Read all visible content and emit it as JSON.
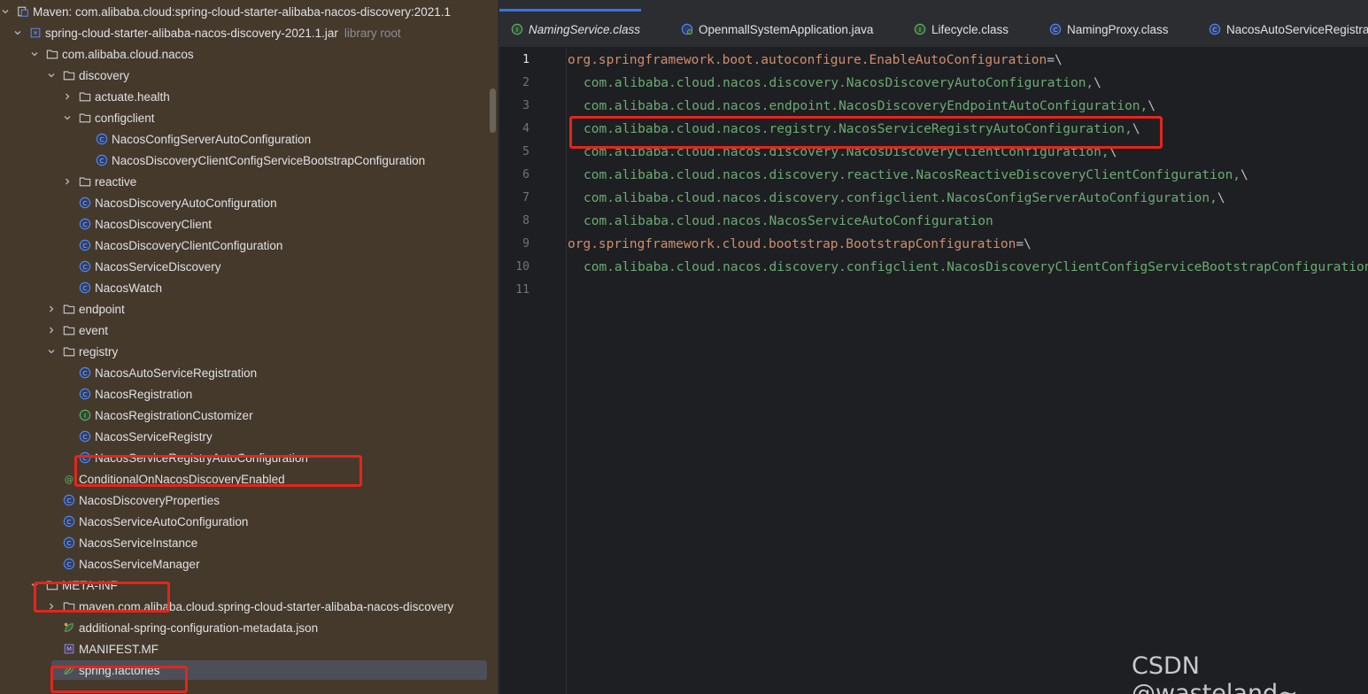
{
  "tree": {
    "rows": [
      {
        "label": "Maven: com.alibaba.cloud:spring-cloud-starter-alibaba-nacos-discovery:2021.1",
        "icon": "library-icon",
        "chev": "down"
      },
      {
        "label": "spring-cloud-starter-alibaba-nacos-discovery-2021.1.jar",
        "hint": "library root",
        "icon": "jar-icon",
        "chev": "down"
      },
      {
        "label": "com.alibaba.cloud.nacos",
        "icon": "folder-icon",
        "chev": "down"
      },
      {
        "label": "discovery",
        "icon": "folder-icon",
        "chev": "down"
      },
      {
        "label": "actuate.health",
        "icon": "folder-icon",
        "chev": "right"
      },
      {
        "label": "configclient",
        "icon": "folder-icon",
        "chev": "down"
      },
      {
        "label": "NacosConfigServerAutoConfiguration",
        "icon": "class-icon",
        "chev": ""
      },
      {
        "label": "NacosDiscoveryClientConfigServiceBootstrapConfiguration",
        "icon": "class-icon",
        "chev": ""
      },
      {
        "label": "reactive",
        "icon": "folder-icon",
        "chev": "right"
      },
      {
        "label": "NacosDiscoveryAutoConfiguration",
        "icon": "class-icon",
        "chev": ""
      },
      {
        "label": "NacosDiscoveryClient",
        "icon": "class-icon",
        "chev": ""
      },
      {
        "label": "NacosDiscoveryClientConfiguration",
        "icon": "class-icon",
        "chev": ""
      },
      {
        "label": "NacosServiceDiscovery",
        "icon": "class-icon",
        "chev": ""
      },
      {
        "label": "NacosWatch",
        "icon": "class-icon",
        "chev": ""
      },
      {
        "label": "endpoint",
        "icon": "folder-icon",
        "chev": "right"
      },
      {
        "label": "event",
        "icon": "folder-icon",
        "chev": "right"
      },
      {
        "label": "registry",
        "icon": "folder-icon",
        "chev": "down"
      },
      {
        "label": "NacosAutoServiceRegistration",
        "icon": "class-icon",
        "chev": ""
      },
      {
        "label": "NacosRegistration",
        "icon": "class-icon",
        "chev": ""
      },
      {
        "label": "NacosRegistrationCustomizer",
        "icon": "interface-icon",
        "chev": ""
      },
      {
        "label": "NacosServiceRegistry",
        "icon": "class-icon",
        "chev": ""
      },
      {
        "label": "NacosServiceRegistryAutoConfiguration",
        "icon": "class-icon",
        "chev": ""
      },
      {
        "label": "ConditionalOnNacosDiscoveryEnabled",
        "icon": "annotation-icon",
        "chev": ""
      },
      {
        "label": "NacosDiscoveryProperties",
        "icon": "class-icon",
        "chev": ""
      },
      {
        "label": "NacosServiceAutoConfiguration",
        "icon": "class-icon",
        "chev": ""
      },
      {
        "label": "NacosServiceInstance",
        "icon": "class-icon",
        "chev": ""
      },
      {
        "label": "NacosServiceManager",
        "icon": "class-icon",
        "chev": ""
      },
      {
        "label": "META-INF",
        "icon": "folder-icon",
        "chev": "down"
      },
      {
        "label": "maven.com.alibaba.cloud.spring-cloud-starter-alibaba-nacos-discovery",
        "icon": "folder-icon",
        "chev": "right"
      },
      {
        "label": "additional-spring-configuration-metadata.json",
        "icon": "json-spring-icon",
        "chev": ""
      },
      {
        "label": "MANIFEST.MF",
        "icon": "manifest-icon",
        "chev": ""
      },
      {
        "label": "spring.factories",
        "icon": "spring-factories-icon",
        "chev": ""
      }
    ]
  },
  "tabs": [
    {
      "label": "NamingService.class",
      "icon": "interface-icon"
    },
    {
      "label": "OpenmallSystemApplication.java",
      "icon": "spring-class-icon"
    },
    {
      "label": "Lifecycle.class",
      "icon": "interface-icon"
    },
    {
      "label": "NamingProxy.class",
      "icon": "class-icon"
    },
    {
      "label": "NacosAutoServiceRegistra",
      "icon": "class-icon"
    }
  ],
  "editor": {
    "line_numbers": [
      "1",
      "2",
      "3",
      "4",
      "5",
      "6",
      "7",
      "8",
      "9",
      "10",
      "11"
    ],
    "lines": [
      {
        "key": "org.springframework.boot.autoconfigure.EnableAutoConfiguration",
        "sep": "=\\"
      },
      {
        "val": "com.alibaba.cloud.nacos.discovery.NacosDiscoveryAutoConfiguration,",
        "sep": "\\"
      },
      {
        "val": "com.alibaba.cloud.nacos.endpoint.NacosDiscoveryEndpointAutoConfiguration,",
        "sep": "\\"
      },
      {
        "val": "com.alibaba.cloud.nacos.registry.NacosServiceRegistryAutoConfiguration,",
        "sep": "\\"
      },
      {
        "val": "com.alibaba.cloud.nacos.discovery.NacosDiscoveryClientConfiguration,",
        "sep": "\\"
      },
      {
        "val": "com.alibaba.cloud.nacos.discovery.reactive.NacosReactiveDiscoveryClientConfiguration,",
        "sep": "\\"
      },
      {
        "val": "com.alibaba.cloud.nacos.discovery.configclient.NacosConfigServerAutoConfiguration,",
        "sep": "\\"
      },
      {
        "val": "com.alibaba.cloud.nacos.NacosServiceAutoConfiguration",
        "sep": ""
      },
      {
        "key": "org.springframework.cloud.bootstrap.BootstrapConfiguration",
        "sep": "=\\"
      },
      {
        "val": "com.alibaba.cloud.nacos.discovery.configclient.NacosDiscoveryClientConfigServiceBootstrapConfiguration",
        "sep": ""
      },
      {
        "val": "",
        "sep": ""
      }
    ]
  },
  "watermark": "CSDN @wasteland~",
  "colors": {
    "tree_bg": "#45392b",
    "editor_bg": "#1e1f22",
    "key": "#cf8e6d",
    "value": "#6aab73",
    "annotation_red": "#e3261c",
    "accent": "#3574f0"
  }
}
